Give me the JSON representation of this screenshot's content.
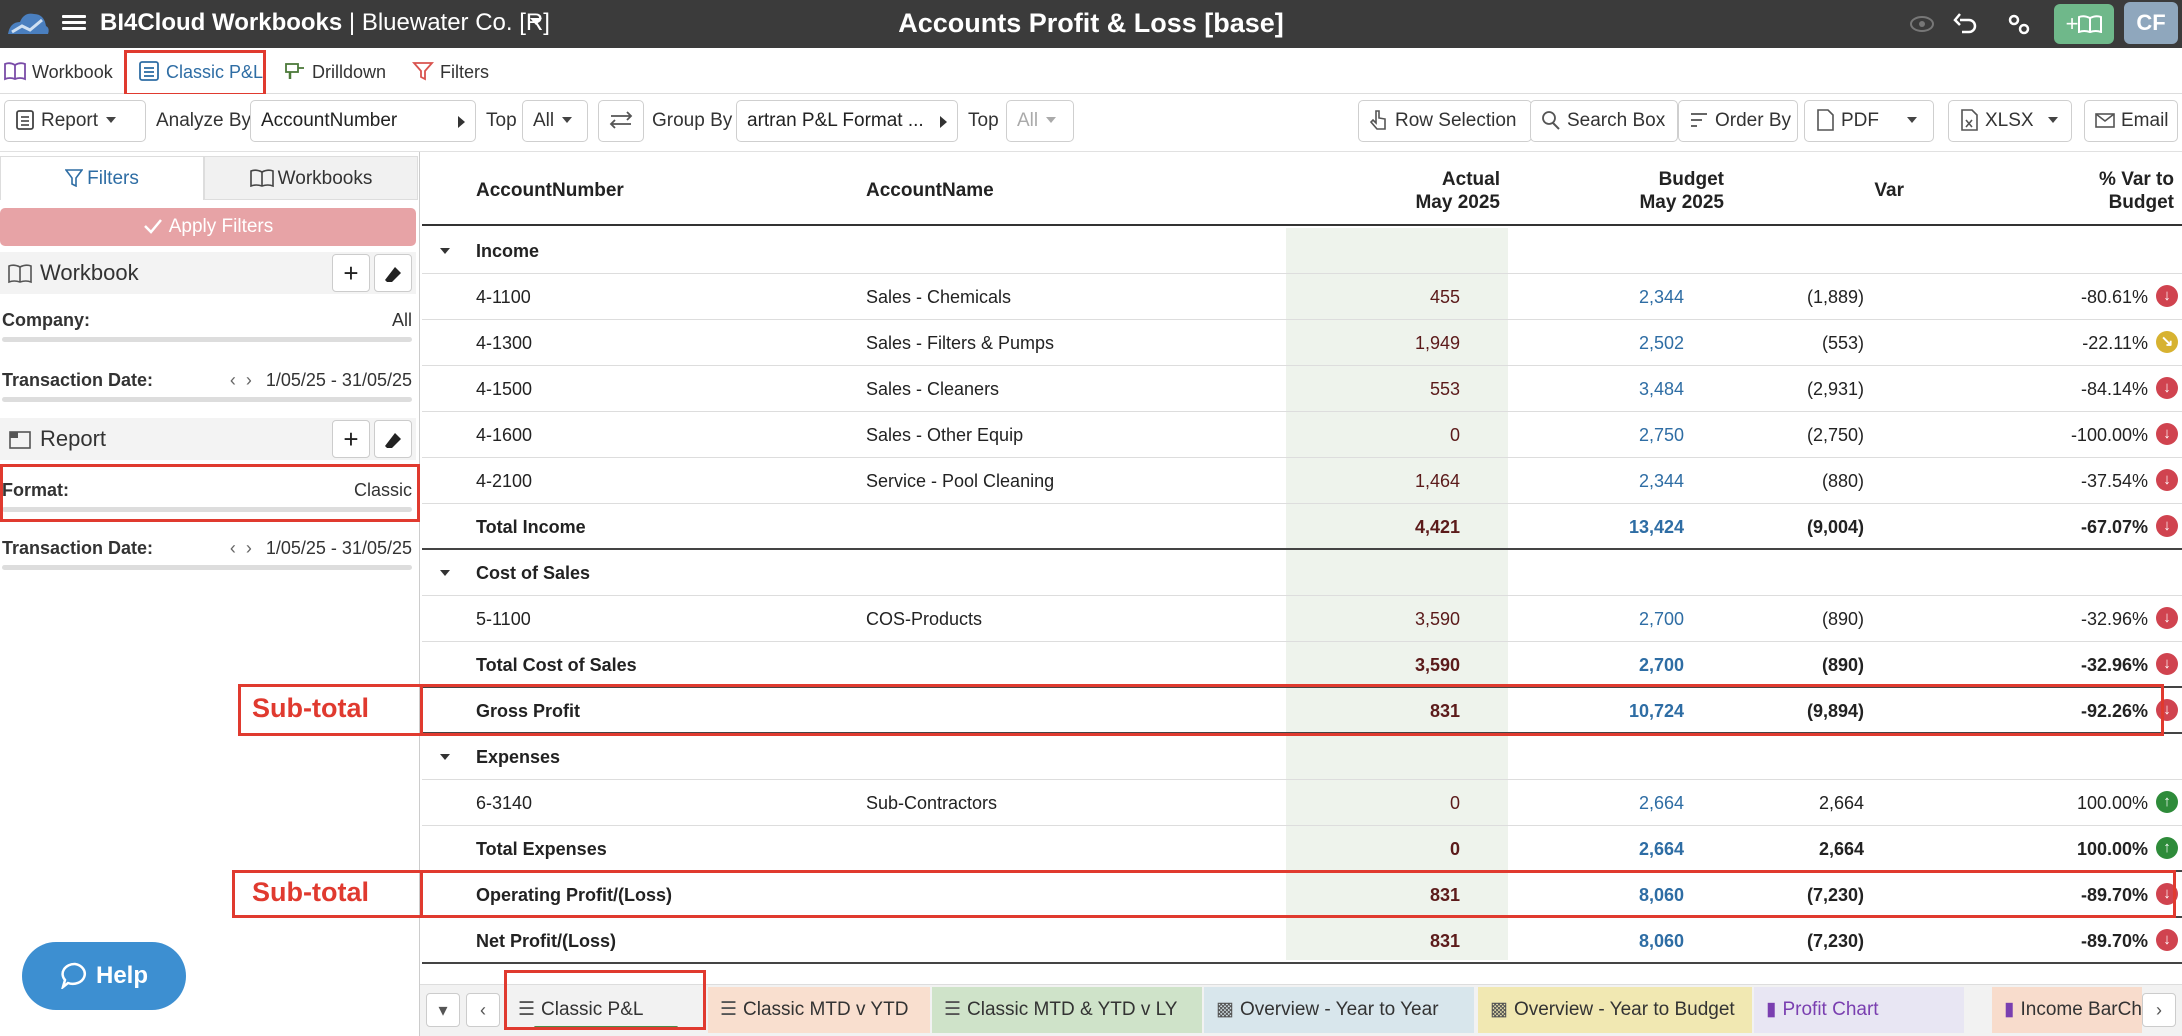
{
  "titlebar": {
    "app_name": "BI4Cloud Workbooks",
    "company": "| Bluewater Co. [R]",
    "page_title": "Accounts Profit & Loss [base]",
    "avatar": "CF",
    "add_workbook_label": "+"
  },
  "nav": {
    "items": [
      {
        "label": "Workbook"
      },
      {
        "label": "Classic P&L"
      },
      {
        "label": "Drilldown"
      },
      {
        "label": "Filters"
      }
    ]
  },
  "toolbar": {
    "report_label": "Report",
    "analyze_by_label": "Analyze By",
    "analyze_by_value": "AccountNumber",
    "top1_label": "Top",
    "top1_value": "All",
    "group_by_label": "Group By",
    "group_by_value": "artran P&L Format ...",
    "top2_label": "Top",
    "top2_value": "All",
    "row_selection": "Row Selection",
    "search_box": "Search Box",
    "order_by": "Order By",
    "pdf": "PDF",
    "xlsx": "XLSX",
    "email": "Email"
  },
  "left": {
    "tab_filters": "Filters",
    "tab_workbooks": "Workbooks",
    "apply_filters": "Apply Filters",
    "workbook_section": "Workbook",
    "company_label": "Company:",
    "company_value": "All",
    "txn_date_label": "Transaction Date:",
    "txn_date_value": "1/05/25 - 31/05/25",
    "report_section": "Report",
    "format_label": "Format:",
    "format_value": "Classic",
    "txn_date2_label": "Transaction Date:",
    "txn_date2_value": "1/05/25 - 31/05/25",
    "help": "Help"
  },
  "annotations": {
    "subtotal_1": "Sub-total",
    "subtotal_2": "Sub-total"
  },
  "table": {
    "headers": {
      "account_number": "AccountNumber",
      "account_name": "AccountName",
      "actual_1": "Actual",
      "actual_2": "May 2025",
      "budget_1": "Budget",
      "budget_2": "May 2025",
      "var": "Var",
      "pct_1": "% Var to",
      "pct_2": "Budget"
    },
    "rows": [
      {
        "type": "group",
        "acct": "Income"
      },
      {
        "type": "line",
        "acct": "4-1100",
        "name": "Sales - Chemicals",
        "actual": "455",
        "budget": "2,344",
        "var": "(1,889)",
        "pct": "-80.61%",
        "trend": "down"
      },
      {
        "type": "line",
        "acct": "4-1300",
        "name": "Sales - Filters & Pumps",
        "actual": "1,949",
        "budget": "2,502",
        "var": "(553)",
        "pct": "-22.11%",
        "trend": "mid"
      },
      {
        "type": "line",
        "acct": "4-1500",
        "name": "Sales - Cleaners",
        "actual": "553",
        "budget": "3,484",
        "var": "(2,931)",
        "pct": "-84.14%",
        "trend": "down"
      },
      {
        "type": "line",
        "acct": "4-1600",
        "name": "Sales - Other Equip",
        "actual": "0",
        "budget": "2,750",
        "var": "(2,750)",
        "pct": "-100.00%",
        "trend": "down"
      },
      {
        "type": "line",
        "acct": "4-2100",
        "name": "Service - Pool Cleaning",
        "actual": "1,464",
        "budget": "2,344",
        "var": "(880)",
        "pct": "-37.54%",
        "trend": "down"
      },
      {
        "type": "total",
        "acct": "Total Income",
        "name": "",
        "actual": "4,421",
        "budget": "13,424",
        "var": "(9,004)",
        "pct": "-67.07%",
        "trend": "down"
      },
      {
        "type": "group",
        "acct": "Cost of Sales"
      },
      {
        "type": "line",
        "acct": "5-1100",
        "name": "COS-Products",
        "actual": "3,590",
        "budget": "2,700",
        "var": "(890)",
        "pct": "-32.96%",
        "trend": "down"
      },
      {
        "type": "total",
        "acct": "Total Cost of Sales",
        "name": "",
        "actual": "3,590",
        "budget": "2,700",
        "var": "(890)",
        "pct": "-32.96%",
        "trend": "down"
      },
      {
        "type": "total",
        "acct": "Gross Profit",
        "name": "",
        "actual": "831",
        "budget": "10,724",
        "var": "(9,894)",
        "pct": "-92.26%",
        "trend": "down"
      },
      {
        "type": "group",
        "acct": "Expenses"
      },
      {
        "type": "line",
        "acct": "6-3140",
        "name": "Sub-Contractors",
        "actual": "0",
        "budget": "2,664",
        "var": "2,664",
        "pct": "100.00%",
        "trend": "up"
      },
      {
        "type": "total",
        "acct": "Total Expenses",
        "name": "",
        "actual": "0",
        "budget": "2,664",
        "var": "2,664",
        "pct": "100.00%",
        "trend": "up"
      },
      {
        "type": "total",
        "acct": "Operating Profit/(Loss)",
        "name": "",
        "actual": "831",
        "budget": "8,060",
        "var": "(7,230)",
        "pct": "-89.70%",
        "trend": "down"
      },
      {
        "type": "total",
        "acct": "Net Profit/(Loss)",
        "name": "",
        "actual": "831",
        "budget": "8,060",
        "var": "(7,230)",
        "pct": "-89.70%",
        "trend": "down"
      }
    ]
  },
  "bottom_tabs": [
    {
      "label": "Classic P&L",
      "bg": "#f2f2f2"
    },
    {
      "label": "Classic MTD v YTD",
      "bg": "#f9dfcf"
    },
    {
      "label": "Classic MTD & YTD  v LY",
      "bg": "#cfe3c9"
    },
    {
      "label": "Overview - Year to Year",
      "bg": "#d8e6ec"
    },
    {
      "label": "Overview - Year to Budget",
      "bg": "#f1e8b2"
    },
    {
      "label": "Profit Chart",
      "bg": "#e8e6f3"
    },
    {
      "label": "Income BarCha",
      "bg": "#f8dccc"
    }
  ],
  "colors": {
    "accent": "#2e6da4",
    "annotation_red": "#e03a2f",
    "down": "#d0434f",
    "neutral": "#d7b231",
    "up": "#2e8b3a"
  }
}
